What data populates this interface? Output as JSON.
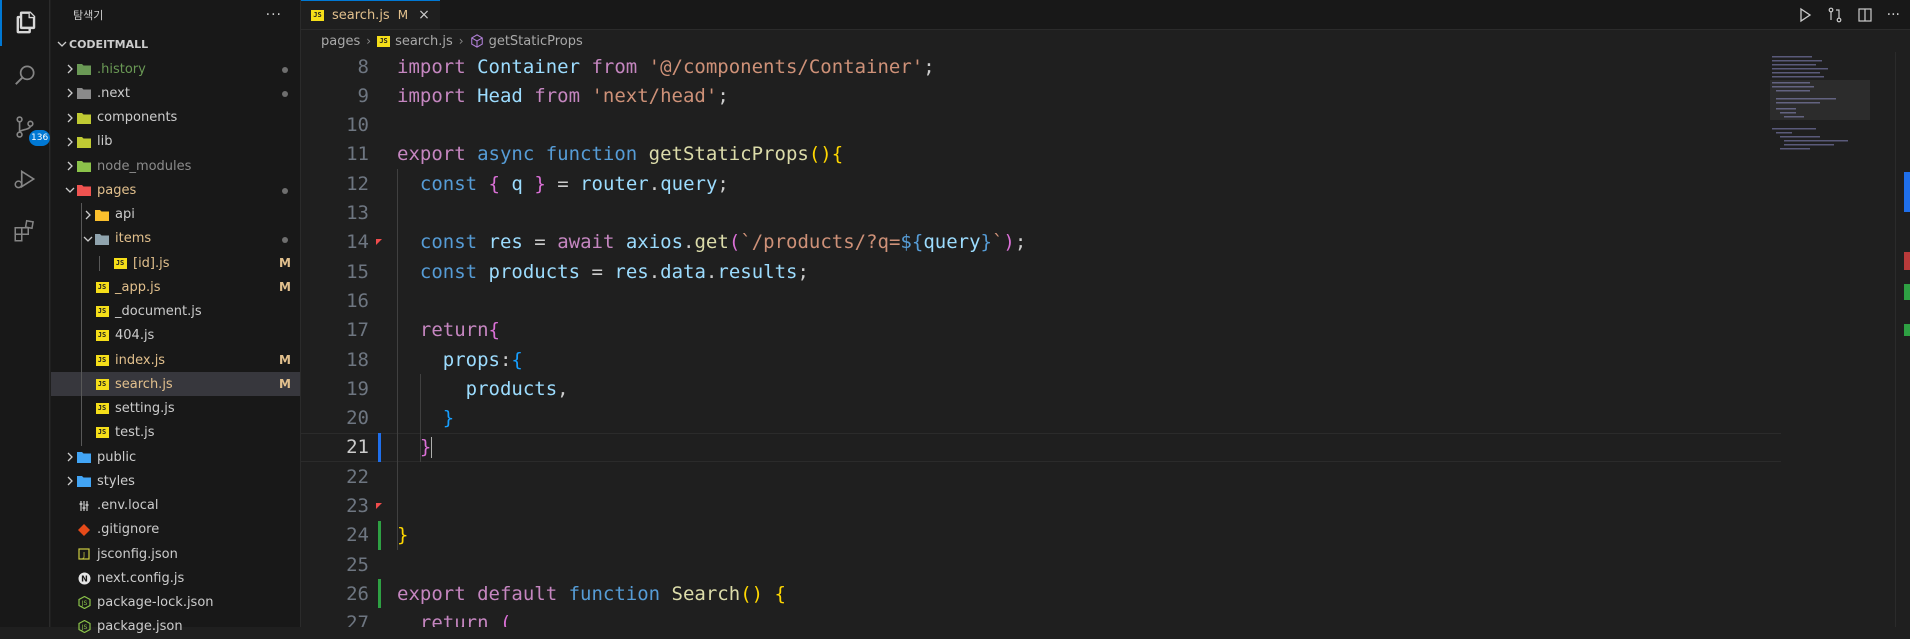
{
  "activity_bar": {
    "items": [
      {
        "icon": "files-icon"
      },
      {
        "icon": "search-icon"
      },
      {
        "icon": "source-control-icon",
        "badge": "136"
      },
      {
        "icon": "run-debug-icon"
      },
      {
        "icon": "extensions-icon"
      }
    ]
  },
  "sidebar": {
    "title": "탐색기",
    "more": "···",
    "section": "CODEITMALL",
    "tree": [
      {
        "name": ".history",
        "type": "folder",
        "icon": "folder-history-icon",
        "color": "#6a9955",
        "status": "dot"
      },
      {
        "name": ".next",
        "type": "folder",
        "icon": "folder-next-icon",
        "color": "#cccccc",
        "status": "dot"
      },
      {
        "name": "components",
        "type": "folder",
        "icon": "folder-components-icon",
        "color": "#cccccc",
        "status": ""
      },
      {
        "name": "lib",
        "type": "folder",
        "icon": "folder-lib-icon",
        "color": "#cccccc",
        "status": ""
      },
      {
        "name": "node_modules",
        "type": "folder",
        "icon": "folder-node-icon",
        "color": "#8c8c8c",
        "status": ""
      },
      {
        "name": "pages",
        "type": "folder-open",
        "icon": "folder-pages-icon",
        "color": "#e2c08d",
        "status": "dot"
      },
      {
        "name": "api",
        "type": "folder",
        "icon": "folder-api-icon",
        "color": "#cccccc",
        "status": ""
      },
      {
        "name": "items",
        "type": "folder-open",
        "icon": "folder-items-icon",
        "color": "#e2c08d",
        "status": "dot"
      },
      {
        "name": "[id].js",
        "type": "file",
        "icon": "js-file-icon",
        "color": "#e2c08d",
        "status": "M"
      },
      {
        "name": "_app.js",
        "type": "file",
        "icon": "js-file-icon",
        "color": "#e2c08d",
        "status": "M"
      },
      {
        "name": "_document.js",
        "type": "file",
        "icon": "js-file-icon",
        "color": "#cccccc",
        "status": ""
      },
      {
        "name": "404.js",
        "type": "file",
        "icon": "js-file-icon",
        "color": "#cccccc",
        "status": ""
      },
      {
        "name": "index.js",
        "type": "file",
        "icon": "js-file-icon",
        "color": "#e2c08d",
        "status": "M"
      },
      {
        "name": "search.js",
        "type": "file",
        "icon": "js-file-icon",
        "color": "#e2c08d",
        "status": "M"
      },
      {
        "name": "setting.js",
        "type": "file",
        "icon": "js-file-icon",
        "color": "#cccccc",
        "status": ""
      },
      {
        "name": "test.js",
        "type": "file",
        "icon": "js-file-icon",
        "color": "#cccccc",
        "status": ""
      },
      {
        "name": "public",
        "type": "folder",
        "icon": "folder-public-icon",
        "color": "#cccccc",
        "status": ""
      },
      {
        "name": "styles",
        "type": "folder",
        "icon": "folder-styles-icon",
        "color": "#cccccc",
        "status": ""
      },
      {
        "name": ".env.local",
        "type": "file",
        "icon": "env-file-icon",
        "color": "#cccccc",
        "status": ""
      },
      {
        "name": ".gitignore",
        "type": "file",
        "icon": "git-file-icon",
        "color": "#cccccc",
        "status": ""
      },
      {
        "name": "jsconfig.json",
        "type": "file",
        "icon": "json-file-icon",
        "color": "#cccccc",
        "status": ""
      },
      {
        "name": "next.config.js",
        "type": "file",
        "icon": "next-file-icon",
        "color": "#cccccc",
        "status": ""
      },
      {
        "name": "package-lock.json",
        "type": "file",
        "icon": "npm-file-icon",
        "color": "#cccccc",
        "status": ""
      },
      {
        "name": "package.json",
        "type": "file",
        "icon": "npm-file-icon",
        "color": "#cccccc",
        "status": ""
      }
    ]
  },
  "editor": {
    "tab": {
      "icon_text": "JS",
      "label": "search.js",
      "modified": "M",
      "close": "×"
    },
    "breadcrumb": [
      "pages",
      "search.js",
      "getStaticProps"
    ],
    "lines": [
      {
        "n": "8",
        "tokens": [
          [
            "k",
            "import "
          ],
          [
            "v",
            "Container "
          ],
          [
            "k",
            "from "
          ],
          [
            "s",
            "'@/components/Container'"
          ],
          [
            "p",
            ";"
          ]
        ]
      },
      {
        "n": "9",
        "tokens": [
          [
            "k",
            "import "
          ],
          [
            "v",
            "Head "
          ],
          [
            "k",
            "from "
          ],
          [
            "s",
            "'next/head'"
          ],
          [
            "p",
            ";"
          ]
        ]
      },
      {
        "n": "10",
        "tokens": []
      },
      {
        "n": "11",
        "tokens": [
          [
            "k",
            "export "
          ],
          [
            "kb",
            "async "
          ],
          [
            "kb",
            "function "
          ],
          [
            "f",
            "getStaticProps"
          ],
          [
            "b1",
            "()"
          ],
          [
            "b1",
            "{"
          ]
        ]
      },
      {
        "n": "12",
        "tokens": [
          [
            "p",
            "  "
          ],
          [
            "kb",
            "const "
          ],
          [
            "b2",
            "{ "
          ],
          [
            "v",
            "q "
          ],
          [
            "b2",
            "}"
          ],
          [
            "p",
            " = "
          ],
          [
            "v",
            "router"
          ],
          [
            "p",
            "."
          ],
          [
            "v",
            "query"
          ],
          [
            "p",
            ";"
          ]
        ]
      },
      {
        "n": "13",
        "tokens": []
      },
      {
        "n": "14",
        "tokens": [
          [
            "p",
            "  "
          ],
          [
            "kb",
            "const "
          ],
          [
            "v",
            "res"
          ],
          [
            "p",
            " = "
          ],
          [
            "k",
            "await "
          ],
          [
            "v",
            "axios"
          ],
          [
            "p",
            "."
          ],
          [
            "f",
            "get"
          ],
          [
            "b2",
            "("
          ],
          [
            "s",
            "`/products/?q="
          ],
          [
            "kb",
            "${"
          ],
          [
            "v",
            "query"
          ],
          [
            "kb",
            "}"
          ],
          [
            "s",
            "`"
          ],
          [
            "b2",
            ")"
          ],
          [
            "p",
            ";"
          ]
        ]
      },
      {
        "n": "15",
        "tokens": [
          [
            "p",
            "  "
          ],
          [
            "kb",
            "const "
          ],
          [
            "v",
            "products"
          ],
          [
            "p",
            " = "
          ],
          [
            "v",
            "res"
          ],
          [
            "p",
            "."
          ],
          [
            "v",
            "data"
          ],
          [
            "p",
            "."
          ],
          [
            "v",
            "results"
          ],
          [
            "p",
            ";"
          ]
        ]
      },
      {
        "n": "16",
        "tokens": []
      },
      {
        "n": "17",
        "tokens": [
          [
            "p",
            "  "
          ],
          [
            "k",
            "return"
          ],
          [
            "b2",
            "{"
          ]
        ]
      },
      {
        "n": "18",
        "tokens": [
          [
            "p",
            "    "
          ],
          [
            "v",
            "props"
          ],
          [
            "p",
            ":"
          ],
          [
            "b3",
            "{"
          ]
        ]
      },
      {
        "n": "19",
        "tokens": [
          [
            "p",
            "      "
          ],
          [
            "v",
            "products"
          ],
          [
            "p",
            ","
          ]
        ]
      },
      {
        "n": "20",
        "tokens": [
          [
            "p",
            "    "
          ],
          [
            "b3",
            "}"
          ]
        ]
      },
      {
        "n": "21",
        "tokens": [
          [
            "p",
            "  "
          ],
          [
            "b2",
            "}"
          ]
        ]
      },
      {
        "n": "22",
        "tokens": []
      },
      {
        "n": "23",
        "tokens": []
      },
      {
        "n": "24",
        "tokens": [
          [
            "b1",
            "}"
          ]
        ]
      },
      {
        "n": "25",
        "tokens": []
      },
      {
        "n": "26",
        "tokens": [
          [
            "k",
            "export "
          ],
          [
            "k",
            "default "
          ],
          [
            "kb",
            "function "
          ],
          [
            "f",
            "Search"
          ],
          [
            "b1",
            "() {"
          ]
        ]
      },
      {
        "n": "27",
        "tokens": [
          [
            "p",
            "  "
          ],
          [
            "k",
            "return "
          ],
          [
            "b2",
            "("
          ]
        ]
      }
    ],
    "current_line": "21",
    "gutter_marks": {
      "14": "red-triangle",
      "21": "blue",
      "23": "red-triangle",
      "24": "green",
      "26": "green"
    },
    "colors": {
      "accent": "#0078d4",
      "modified": "#e2c08d",
      "added": "#2ea043",
      "deleted": "#f14c4c"
    }
  }
}
